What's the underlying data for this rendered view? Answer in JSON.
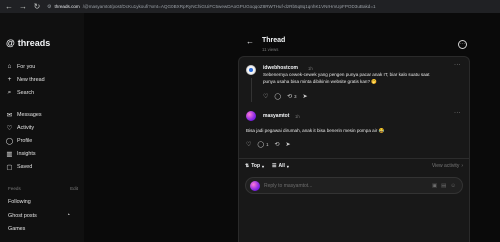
{
  "browser": {
    "url_domain": "threads.com",
    "url_path": "/@masyamtot/post/DcKu1ykoufi?xmt=AQG0BXRpRyNChiGUiFC5wewDAoGPUGoqqoZ8RWTHuf-dzRb5q8q1qnhK1VNrHmUpFPOD3uBakd=1",
    "back_icon": "←",
    "forward_icon": "→",
    "reload_icon": "↻"
  },
  "sidebar": {
    "logo_icon": "threads-logo-icon",
    "logo_text": "threads",
    "items": [
      {
        "label": "For you",
        "icon": "⌂",
        "icon_name": "home-icon"
      },
      {
        "label": "New thread",
        "icon": "+",
        "icon_name": "plus-icon"
      },
      {
        "label": "Search",
        "icon": "⌕",
        "icon_name": "search-icon"
      },
      {
        "label": "Messages",
        "icon": "✉",
        "icon_name": "message-icon"
      },
      {
        "label": "Activity",
        "icon": "♡",
        "icon_name": "heart-icon"
      },
      {
        "label": "Profile",
        "icon": "◯",
        "icon_name": "profile-icon"
      },
      {
        "label": "Insights",
        "icon": "▥",
        "icon_name": "insights-icon"
      },
      {
        "label": "Saved",
        "icon": "▢",
        "icon_name": "bookmark-icon"
      }
    ],
    "feeds_label": "Feeds",
    "edit_label": "Edit",
    "feeds": [
      "Following",
      "Ghost posts",
      "Games"
    ],
    "ghost_icon": "◔"
  },
  "header": {
    "title": "Thread",
    "views": "11 views",
    "back_icon": "←",
    "more_icon": "···"
  },
  "posts": [
    {
      "username": "idwebhostcom",
      "time": "1h",
      "text_line1": "Sebenernya cewek-cewek yang pengen punya pacar anak IT, biar kalo suatu saat",
      "text_line2": "punya usaha bisa minta dibikinin website gratis kan? 🤭",
      "more": "···",
      "repost_count": "3",
      "reply_count": "",
      "share_count": ""
    },
    {
      "username": "masyamtot",
      "time": "1h",
      "text": "Bisa jadi pegawai dirumah, anak it bisa benerin mesin pompa air 😂",
      "more": "···",
      "reply_count": "1"
    }
  ],
  "filters": {
    "top": "Top",
    "all": "All",
    "view_activity": "View activity"
  },
  "reply": {
    "placeholder": "Reply to masyamtot..."
  }
}
